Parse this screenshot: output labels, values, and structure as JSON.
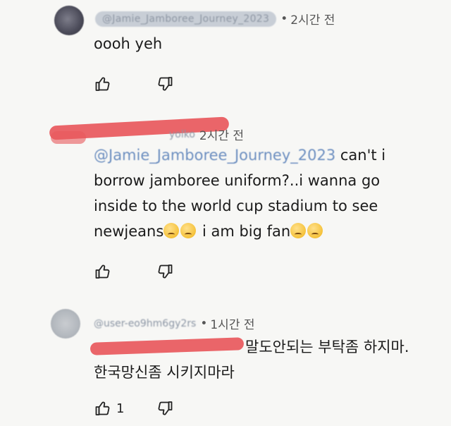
{
  "comments": [
    {
      "handle": "@Jamie_Jamboree_Journey_2023",
      "time": "2시간 전",
      "text": "oooh yeh"
    },
    {
      "handle_partial": "yolko",
      "time": "2시간 전",
      "mention": "@Jamie_Jamboree_Journey_2023",
      "text_line1": " can't i",
      "text_line2": "borrow jamboree uniform?..i wanna go",
      "text_line3": "inside to the world cup stadium to see",
      "text_line4a": "newjeans",
      "text_line4b": " i am big fan",
      "emoji": "crying-face-emoji"
    },
    {
      "handle": "@user-eo9hm6gy2rs",
      "time": "1시간 전",
      "text_line1": "말도안되는 부탁좀 하지마.",
      "text_line2": "한국망신좀 시키지마라",
      "like_count": "1"
    }
  ],
  "icons": {
    "like": "thumbs-up-icon",
    "dislike": "thumbs-down-icon"
  },
  "colors": {
    "mention": "#6d8fc0",
    "redaction": "#e8585c"
  }
}
